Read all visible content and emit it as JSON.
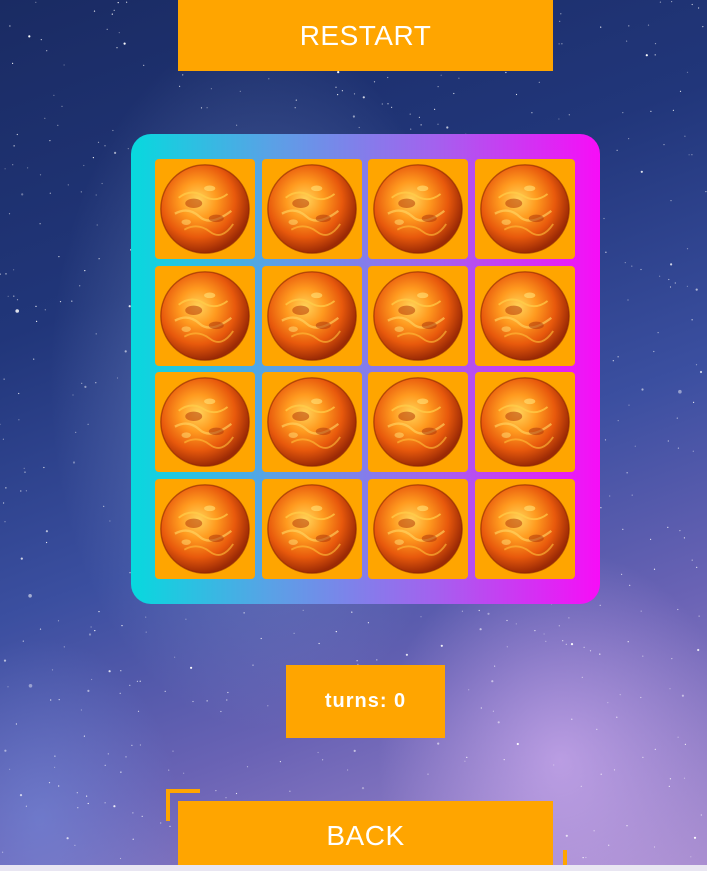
{
  "header": {
    "restart_label": "RESTART"
  },
  "board": {
    "columns": 4,
    "rows": 4,
    "card_back_icon": "sun-icon",
    "card_color": "#ffa500",
    "border_gradient": [
      "#07d9de",
      "#f70df7"
    ],
    "cards": [
      {
        "face": "hidden"
      },
      {
        "face": "hidden"
      },
      {
        "face": "hidden"
      },
      {
        "face": "hidden"
      },
      {
        "face": "hidden"
      },
      {
        "face": "hidden"
      },
      {
        "face": "hidden"
      },
      {
        "face": "hidden"
      },
      {
        "face": "hidden"
      },
      {
        "face": "hidden"
      },
      {
        "face": "hidden"
      },
      {
        "face": "hidden"
      },
      {
        "face": "hidden"
      },
      {
        "face": "hidden"
      },
      {
        "face": "hidden"
      },
      {
        "face": "hidden"
      }
    ]
  },
  "status": {
    "turns_text": "turns: 0"
  },
  "footer": {
    "back_label": "BACK"
  },
  "colors": {
    "accent": "#ffa500",
    "text": "#ffffff"
  }
}
